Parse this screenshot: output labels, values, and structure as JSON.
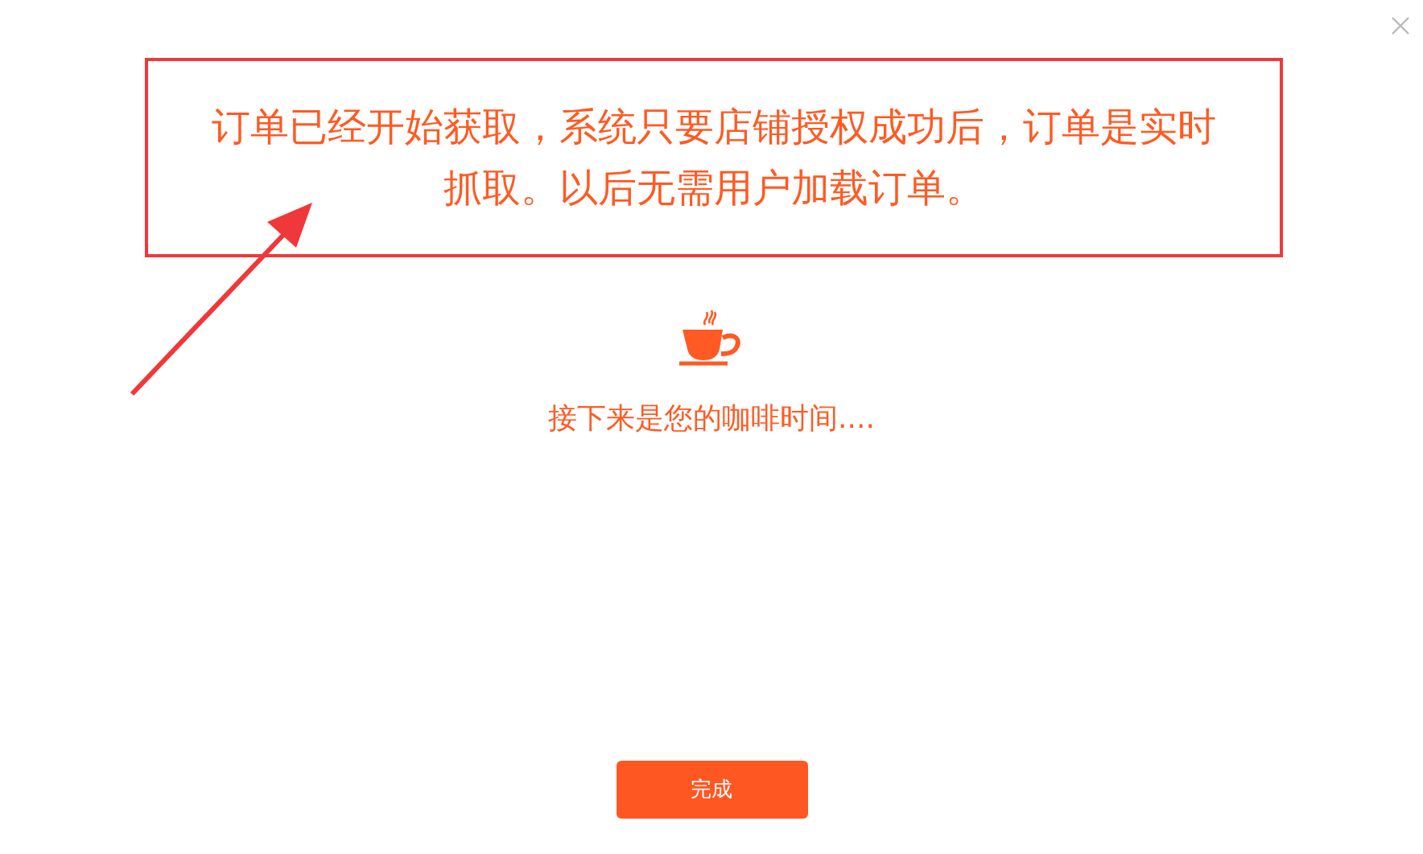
{
  "annotation": {
    "text": "订单已经开始获取，系统只要店铺授权成功后，订单是实时抓取。以后无需用户加载订单。"
  },
  "message": "接下来是您的咖啡时间....",
  "button": "完成"
}
